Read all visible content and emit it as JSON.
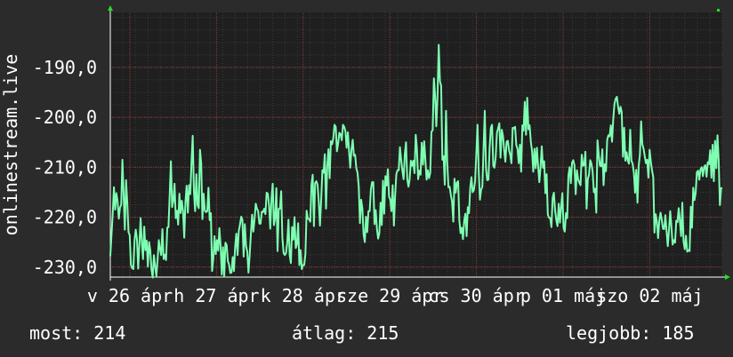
{
  "chart_data": {
    "type": "line",
    "ylabel": "onlinestream.live",
    "yticks": [
      "-190,0",
      "-200,0",
      "-210,0",
      "-220,0",
      "-230,0"
    ],
    "ylim": [
      -232,
      -179
    ],
    "xticks": [
      "v 26 ápr",
      "h 27 ápr",
      "k 28 ápr",
      "sze 29 ápr",
      "cs 30 ápr",
      "p 01 máj",
      "szo 02 máj"
    ],
    "grid": true,
    "series": [
      {
        "color": "#7effb2",
        "values": [
          -227.8,
          -223.5,
          -219.2,
          -214.0,
          -218.5,
          -215.2,
          -216.8,
          -220.3,
          -218.1,
          -217.5,
          -208.5,
          -215.5,
          -222.5,
          -212.6,
          -217.0,
          -223.0,
          -223.6,
          -229.5,
          -230.2,
          -230.4,
          -224.6,
          -222.5,
          -224.4,
          -230.3,
          -225.4,
          -220.2,
          -225.1,
          -228.4,
          -221.9,
          -226.6,
          -224.7,
          -229.9,
          -225.0,
          -226.7,
          -230.6,
          -232.1,
          -227.6,
          -229.8,
          -231.8,
          -228.6,
          -224.6,
          -226.4,
          -227.6,
          -222.4,
          -228.4,
          -227.5,
          -228.6,
          -222.1,
          -222.0,
          -215.5,
          -208.8,
          -218.0,
          -216.7,
          -213.3,
          -220.2,
          -218.7,
          -221.5,
          -215.3,
          -219.2,
          -216.7,
          -218.8,
          -224.1,
          -216.9,
          -213.7,
          -219.1,
          -213.6,
          -215.4,
          -209.0,
          -203.7,
          -214.9,
          -218.8,
          -211.4,
          -217.6,
          -218.2,
          -206.5,
          -209.2,
          -220.4,
          -215.3,
          -218.7,
          -219.0,
          -218.8,
          -214.1,
          -220.6,
          -219.2,
          -230.8,
          -228.3,
          -223.8,
          -227.4,
          -224.6,
          -226.7,
          -222.2,
          -225.7,
          -231.5,
          -226.0,
          -231.9,
          -225.1,
          -225.6,
          -228.8,
          -229.5,
          -231.2,
          -231.1,
          -228.0,
          -230.8,
          -226.0,
          -223.3,
          -227.6,
          -222.8,
          -221.5,
          -219.9,
          -220.5,
          -227.9,
          -221.4,
          -225.8,
          -226.9,
          -231.1,
          -227.6,
          -223.4,
          -219.5,
          -222.9,
          -220.5,
          -217.3,
          -218.3,
          -218.8,
          -221.3,
          -221.3,
          -218.9,
          -219.0,
          -218.3,
          -219.4,
          -215.1,
          -215.3,
          -217.7,
          -222.3,
          -216.3,
          -213.3,
          -221.6,
          -220.2,
          -214.2,
          -226.8,
          -218.3,
          -218.3,
          -214.8,
          -224.2,
          -227.2,
          -227.6,
          -227.2,
          -225.1,
          -220.5,
          -227.6,
          -229.2,
          -222.0,
          -224.5,
          -220.0,
          -226.2,
          -225.4,
          -221.2,
          -229.6,
          -226.6,
          -230.4,
          -229.6,
          -229.6,
          -227.4,
          -218.7,
          -220.3,
          -220.4,
          -220.9,
          -213.6,
          -211.5,
          -221.8,
          -213.2,
          -212.8,
          -213.5,
          -216.9,
          -221.7,
          -216.5,
          -210.6,
          -211.1,
          -207.4,
          -218.3,
          -209.9,
          -206.4,
          -212.2,
          -204.8,
          -205.4,
          -204.2,
          -201.5,
          -201.9,
          -206.8,
          -205.2,
          -203.1,
          -203.4,
          -204.6,
          -201.5,
          -201.9,
          -202.8,
          -206.1,
          -203.0,
          -206.7,
          -210.1,
          -206.5,
          -204.5,
          -207.7,
          -207.5,
          -210.2,
          -211.1,
          -213.9,
          -221.2,
          -216.5,
          -218.3,
          -223.5,
          -225.0,
          -219.9,
          -223.0,
          -218.8,
          -218.8,
          -214.5,
          -213.0,
          -213.0,
          -221.4,
          -218.6,
          -222.3,
          -224.3,
          -223.2,
          -217.1,
          -221.6,
          -212.7,
          -219.3,
          -211.8,
          -213.7,
          -210.4,
          -215.9,
          -216.5,
          -218.8,
          -213.6,
          -221.7,
          -215.8,
          -211.4,
          -210.6,
          -210.6,
          -206.0,
          -208.6,
          -210.7,
          -212.4,
          -207.4,
          -205.0,
          -212.3,
          -213.9,
          -212.4,
          -208.7,
          -209.7,
          -208.7,
          -211.2,
          -203.5,
          -206.3,
          -212.4,
          -210.7,
          -211.5,
          -205.1,
          -209.5,
          -204.8,
          -208.6,
          -212.5,
          -210.6,
          -212.2,
          -211.1,
          -202.9,
          -202.6,
          -192.2,
          -195.6,
          -201.8,
          -195.7,
          -185.5,
          -192.8,
          -193.7,
          -208.5,
          -207.8,
          -213.5,
          -198.7,
          -208.9,
          -214.0,
          -213.9,
          -215.6,
          -216.9,
          -220.9,
          -212.3,
          -215.1,
          -213.1,
          -212.8,
          -220.6,
          -223.2,
          -222.1,
          -224.4,
          -220.7,
          -219.3,
          -223.8,
          -218.0,
          -219.2,
          -214.1,
          -212.0,
          -215.0,
          -214.6,
          -212.7,
          -207.4,
          -201.5,
          -210.9,
          -216.5,
          -214.5,
          -213.9,
          -206.2,
          -198.7,
          -210.2,
          -212.6,
          -212.5,
          -206.1,
          -202.1,
          -201.5,
          -209.7,
          -210.1,
          -207.9,
          -203.1,
          -202.2,
          -201.2,
          -208.1,
          -202.5,
          -203.7,
          -206.6,
          -208.9,
          -204.9,
          -204.7,
          -206.6,
          -207.5,
          -209.2,
          -202.1,
          -202.2,
          -201.9,
          -205.6,
          -206.3,
          -209.2,
          -205.5,
          -210.9,
          -201.6,
          -202.7,
          -196.9,
          -203.5,
          -196.1,
          -202.4,
          -201.6,
          -204.9,
          -206.8,
          -210.9,
          -206.3,
          -210.2,
          -206.1,
          -209.8,
          -213.0,
          -210.0,
          -205.8,
          -210.1,
          -208.8,
          -215.2,
          -211.4,
          -219.5,
          -220.1,
          -220.2,
          -222.0,
          -216.1,
          -215.1,
          -218.6,
          -220.6,
          -221.8,
          -217.3,
          -221.1,
          -218.0,
          -215.2,
          -222.1,
          -222.9,
          -219.2,
          -220.2,
          -211.7,
          -210.0,
          -213.2,
          -209.1,
          -208.6,
          -209.6,
          -215.4,
          -210.6,
          -212.4,
          -213.1,
          -213.6,
          -207.5,
          -209.7,
          -209.6,
          -206.9,
          -218.3,
          -212.4,
          -211.5,
          -208.6,
          -209.3,
          -210.9,
          -215.0,
          -214.3,
          -219.1,
          -204.6,
          -207.5,
          -209.7,
          -209.8,
          -206.4,
          -213.6,
          -209.4,
          -210.8,
          -204.5,
          -203.6,
          -203.8,
          -201.6,
          -204.9,
          -200.4,
          -197.3,
          -196.3,
          -195.9,
          -197.9,
          -199.3,
          -197.9,
          -199.0,
          -207.9,
          -202.1,
          -208.7,
          -207.0,
          -208.7,
          -209.3,
          -202.5,
          -208.7,
          -209.3,
          -211.1,
          -215.1,
          -210.5,
          -217.1,
          -209.7,
          -207.5,
          -200.8,
          -205.4,
          -206.3,
          -207.8,
          -209.2,
          -208.5,
          -212.1,
          -206.5,
          -208.9,
          -210.6,
          -212.0,
          -223.1,
          -219.4,
          -220.9,
          -224.2,
          -220.7,
          -219.1,
          -220.5,
          -222.3,
          -222.4,
          -219.6,
          -222.8,
          -225.8,
          -222.5,
          -218.8,
          -222.0,
          -225.5,
          -224.6,
          -225.1,
          -220.7,
          -221.0,
          -218.2,
          -220.8,
          -223.8,
          -217.1,
          -224.8,
          -226.4,
          -223.7,
          -226.9,
          -226.6,
          -226.8,
          -217.9,
          -222.1,
          -214.1,
          -216.6,
          -215.1,
          -211.0,
          -210.7,
          -212.5,
          -210.4,
          -210.0,
          -211.8,
          -209.9,
          -209.6,
          -211.9,
          -209.0,
          -209.4,
          -206.6,
          -212.1,
          -205.5,
          -212.8,
          -204.7,
          -210.2,
          -203.6,
          -208.7,
          -217.6,
          -214.2,
          -214.2
        ]
      }
    ]
  },
  "stats": {
    "now": "most: 214",
    "avg": "átlag: 215",
    "best": "legjobb: 185"
  },
  "colors": {
    "background": "#2b2b2b",
    "plot_background": "#1f1f1f",
    "grid_minor": "#3a3a3a",
    "grid_major": "#8a3a3a",
    "axis": "#ffffff",
    "arrow": "#20e020",
    "line": "#7effb2",
    "text": "#ffffff"
  }
}
